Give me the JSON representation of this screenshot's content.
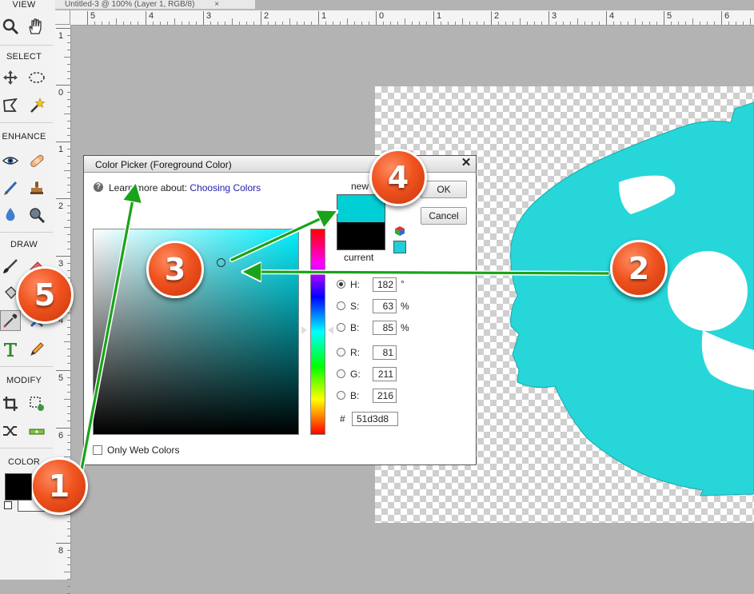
{
  "document_tab": {
    "title": "Untitled-3 @ 100% (Layer 1, RGB/8)",
    "close": "×"
  },
  "toolpanel": {
    "sections": {
      "view": "VIEW",
      "select": "SELECT",
      "enhance": "ENHANCE",
      "draw": "DRAW",
      "modify": "MODIFY",
      "color": "COLOR"
    },
    "foreground_color": "#000000",
    "background_color": "#ffffff"
  },
  "rulers": {
    "horizontal": [
      "5",
      "4",
      "3",
      "2",
      "1",
      "0",
      "1",
      "2",
      "3",
      "4",
      "5",
      "6"
    ],
    "vertical": [
      "1",
      "0",
      "1",
      "2",
      "3",
      "4",
      "5",
      "6",
      "7",
      "8"
    ]
  },
  "dialog": {
    "title": "Color Picker (Foreground Color)",
    "close": "✕",
    "learn_prefix": "Learn more about:",
    "learn_link": "Choosing Colors",
    "ok": "OK",
    "cancel": "Cancel",
    "new_label": "new",
    "current_label": "current",
    "new_color": "#00cfd6",
    "current_color": "#000000",
    "web_swatch_color": "#1ecfd6",
    "only_web_colors": "Only Web Colors",
    "hue_color": "#00f0ff",
    "fields": {
      "h": {
        "label": "H:",
        "value": "182",
        "unit": "°"
      },
      "s": {
        "label": "S:",
        "value": "63",
        "unit": "%"
      },
      "b": {
        "label": "B:",
        "value": "85",
        "unit": "%"
      },
      "r": {
        "label": "R:",
        "value": "81"
      },
      "g": {
        "label": "G:",
        "value": "211"
      },
      "bl": {
        "label": "B:",
        "value": "216"
      },
      "hex": {
        "label": "#",
        "value": "51d3d8"
      }
    }
  },
  "canvas": {
    "shape_color": "#27d6d9"
  },
  "callouts": [
    "1",
    "2",
    "3",
    "4",
    "5"
  ],
  "accent": {
    "callout": "#f0531f",
    "arrow": "#1aa31a"
  }
}
